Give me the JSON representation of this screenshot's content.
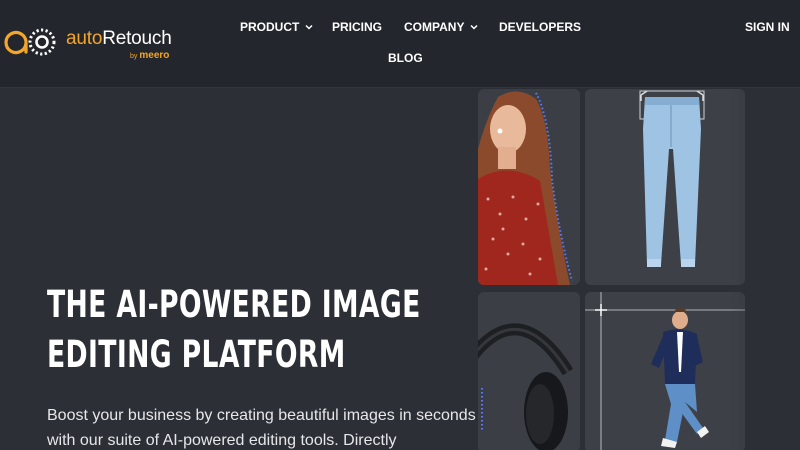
{
  "brand": {
    "name_prefix": "auto",
    "name_suffix": "Retouch",
    "by_label": "by",
    "parent": "meero",
    "accent_color": "#f4a62a"
  },
  "nav": {
    "items": [
      {
        "label": "PRODUCT",
        "has_dropdown": true
      },
      {
        "label": "PRICING",
        "has_dropdown": false
      },
      {
        "label": "COMPANY",
        "has_dropdown": true
      },
      {
        "label": "DEVELOPERS",
        "has_dropdown": false
      },
      {
        "label": "BLOG",
        "has_dropdown": false
      }
    ],
    "sign_in": "SIGN IN",
    "chevron_icon": "chevron-down-icon"
  },
  "hero": {
    "title_line1": "THE AI-POWERED IMAGE",
    "title_line2": "EDITING PLATFORM",
    "subtitle": "Boost your business by creating beautiful images in seconds with our suite of AI-powered editing tools. Directly",
    "tiles": [
      {
        "image": "woman-red-dress-photo"
      },
      {
        "image": "jeans-photo"
      },
      {
        "image": "headphones-photo"
      },
      {
        "image": "man-jumping-photo"
      }
    ]
  }
}
